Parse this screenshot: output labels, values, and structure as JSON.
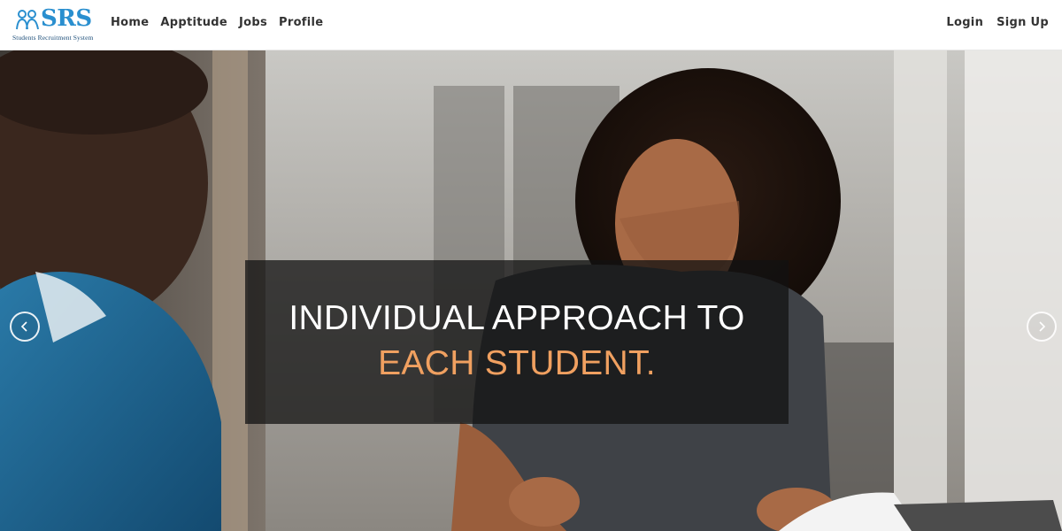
{
  "brand": {
    "logo_text": "SRS",
    "logo_subtitle": "Students Recruitment System",
    "logo_icon": "people-icon",
    "accent_color": "#2a8fcf"
  },
  "nav": {
    "links": [
      {
        "label": "Home"
      },
      {
        "label": "Apptitude"
      },
      {
        "label": "Jobs"
      },
      {
        "label": "Profile"
      }
    ],
    "auth": {
      "login_label": "Login",
      "signup_label": "Sign Up"
    }
  },
  "hero": {
    "caption_line1": "INDIVIDUAL APPROACH TO",
    "caption_line2": "EACH STUDENT.",
    "caption_highlight_color": "#f0a060",
    "prev_icon": "chevron-left-icon",
    "next_icon": "chevron-right-icon"
  }
}
